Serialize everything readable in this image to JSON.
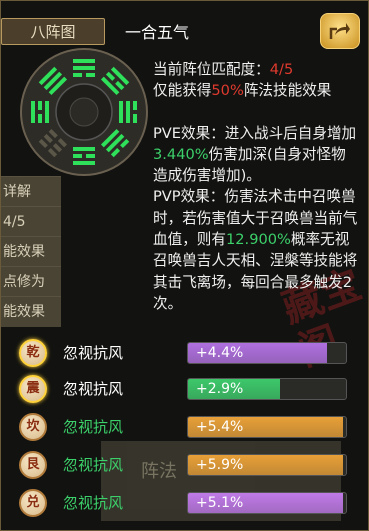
{
  "tab_label": "八阵图",
  "formation_name": "一合五气",
  "match": {
    "label": "当前阵位匹配度：",
    "value": "4/5",
    "prefix": "仅能获得",
    "percent": "50%",
    "suffix": "阵法技能效果"
  },
  "pve": {
    "text1": "PVE效果：进入战斗后自身增加",
    "value": "3.440%",
    "text2": "伤害加深(自身对怪物造成伤害增加)。"
  },
  "pvp": {
    "text1": "PVP效果：伤害法术击中召唤兽时，若伤害值大于召唤兽当前气血值，则有",
    "value": "12.900%",
    "text2": "概率无视召唤兽吉人天相、涅槃等技能将其击飞离场，每回合最多触发2次。"
  },
  "effects": [
    {
      "trigram": "乾",
      "name": "忽视抗风",
      "value": "+4.4%",
      "fraction": 0.88,
      "active": true,
      "name_color": "white",
      "bar_color": "#b070e0"
    },
    {
      "trigram": "震",
      "name": "忽视抗风",
      "value": "+2.9%",
      "fraction": 0.58,
      "active": true,
      "name_color": "white",
      "bar_color": "#3cc86a"
    },
    {
      "trigram": "坎",
      "name": "忽视抗风",
      "value": "+5.4%",
      "fraction": 0.98,
      "active": false,
      "name_color": "green",
      "bar_color": "#e8a038"
    },
    {
      "trigram": "艮",
      "name": "忽视抗风",
      "value": "+5.9%",
      "fraction": 0.98,
      "active": false,
      "name_color": "green",
      "bar_color": "#e8a038"
    },
    {
      "trigram": "兑",
      "name": "忽视抗风",
      "value": "+5.1%",
      "fraction": 0.98,
      "active": false,
      "name_color": "green",
      "bar_color": "#c07ae8"
    }
  ],
  "background": {
    "left_rows": [
      "详解",
      "4/5",
      "能效果",
      "点修为",
      "能效果"
    ],
    "bottom_label": "阵法"
  },
  "icons": {
    "share": "share-icon",
    "bagua": "bagua-icon"
  }
}
